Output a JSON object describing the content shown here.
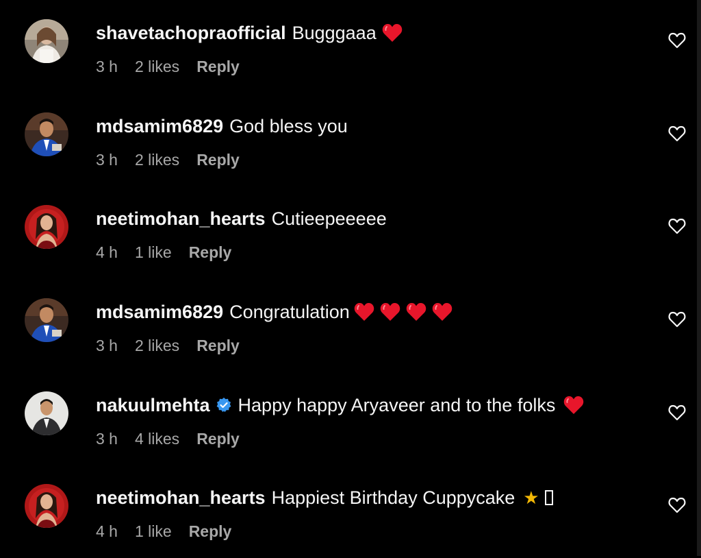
{
  "comments": [
    {
      "username": "shavetachopraofficial",
      "text": "Bugggaaa",
      "emojis": [
        "red-heart"
      ],
      "time": "3 h",
      "likes": "2 likes",
      "reply": "Reply",
      "verified": false,
      "avatar": "avatar-shavetachopra"
    },
    {
      "username": "mdsamim6829",
      "text": "God bless you",
      "emojis": [],
      "time": "3 h",
      "likes": "2 likes",
      "reply": "Reply",
      "verified": false,
      "avatar": "avatar-mdsamim"
    },
    {
      "username": "neetimohan_hearts",
      "text": "Cutieepeeeee",
      "emojis": [],
      "time": "4 h",
      "likes": "1 like",
      "reply": "Reply",
      "verified": false,
      "avatar": "avatar-neetimohan"
    },
    {
      "username": "mdsamim6829",
      "text": "Congratulation",
      "emojis": [
        "red-heart",
        "red-heart",
        "red-heart",
        "red-heart"
      ],
      "time": "3 h",
      "likes": "2 likes",
      "reply": "Reply",
      "verified": false,
      "avatar": "avatar-mdsamim"
    },
    {
      "username": "nakuulmehta",
      "text": "Happy happy Aryaveer and to the folks",
      "emojis": [
        "red-heart"
      ],
      "time": "3 h",
      "likes": "4 likes",
      "reply": "Reply",
      "verified": true,
      "avatar": "avatar-nakuulmehta"
    },
    {
      "username": "neetimohan_hearts",
      "text": "Happiest Birthday Cuppycake",
      "emojis": [
        "star",
        "unsupported-glyph"
      ],
      "time": "4 h",
      "likes": "1 like",
      "reply": "Reply",
      "verified": false,
      "avatar": "avatar-neetimohan"
    }
  ],
  "colors": {
    "background": "#000000",
    "primary_text": "#f5f5f5",
    "secondary_text": "#a8a8a8",
    "heart_red": "#e8162b",
    "verified_blue": "#3897f0",
    "star_yellow": "#f2b705"
  },
  "icons": {
    "like": "heart-outline-icon",
    "verified": "verified-badge-icon"
  }
}
